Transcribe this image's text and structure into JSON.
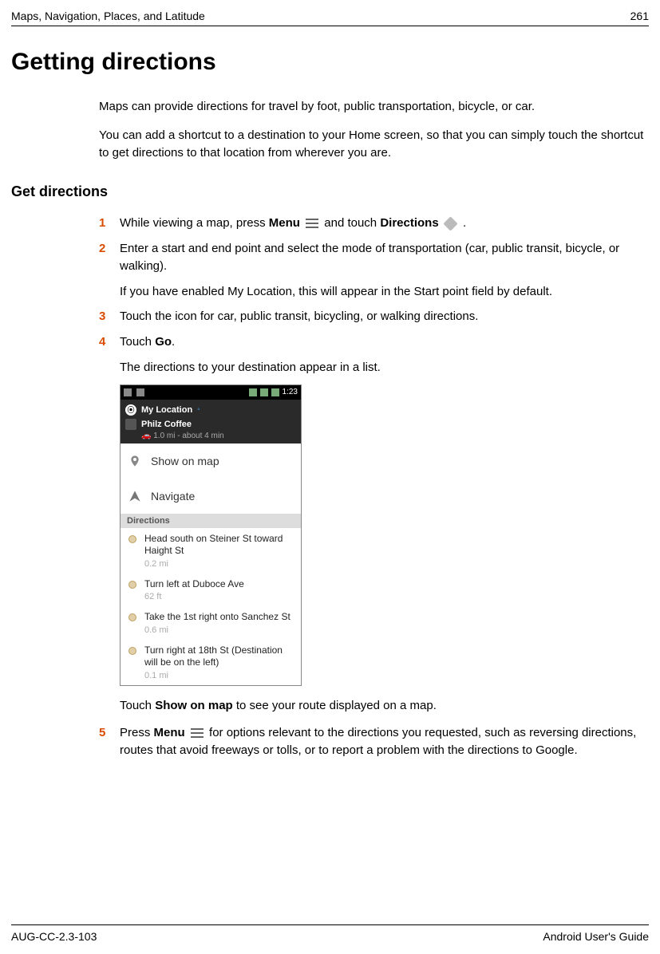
{
  "header": {
    "section": "Maps, Navigation, Places, and Latitude",
    "page_number": "261"
  },
  "title": "Getting directions",
  "intro": [
    "Maps can provide directions for travel by foot, public transportation, bicycle, or car.",
    "You can add a shortcut to a destination to your Home screen, so that you can simply touch the shortcut to get directions to that location from wherever you are."
  ],
  "section_heading": "Get directions",
  "steps": {
    "s1a": "While viewing a map, press ",
    "s1b": "Menu",
    "s1c": " and touch ",
    "s1d": "Directions",
    "s1e": " .",
    "s2a": "Enter a start and end point and select the mode of transportation (car, public transit, bicycle, or walking).",
    "s2b": "If you have enabled My Location, this will appear in the Start point field by default.",
    "s3": "Touch the icon for car, public transit, bicycling, or walking directions.",
    "s4a": "Touch ",
    "s4b": "Go",
    "s4c": ".",
    "s4d": "The directions to your destination appear in a list.",
    "s4e_a": "Touch ",
    "s4e_b": "Show on map",
    "s4e_c": " to see your route displayed on a map.",
    "s5a": "Press ",
    "s5b": "Menu",
    "s5c": " for options relevant to the directions you requested, such as reversing directions, routes that avoid freeways or tolls, or to report a problem with the directions to Google."
  },
  "screenshot": {
    "status_time": "1:23",
    "my_location": "My Location",
    "destination": "Philz Coffee",
    "dest_sub": "1.0 mi - about 4 min",
    "show_on_map": "Show on map",
    "navigate": "Navigate",
    "directions_label": "Directions",
    "dirs": [
      {
        "text": "Head south on Steiner St toward Haight St",
        "dist": "0.2 mi"
      },
      {
        "text": "Turn left at Duboce Ave",
        "dist": "62 ft"
      },
      {
        "text": "Take the 1st right onto Sanchez St",
        "dist": "0.6 mi"
      },
      {
        "text": "Turn right at 18th St (Destination will be on the left)",
        "dist": "0.1 mi"
      }
    ]
  },
  "footer": {
    "doc_id": "AUG-CC-2.3-103",
    "guide": "Android User's Guide"
  }
}
